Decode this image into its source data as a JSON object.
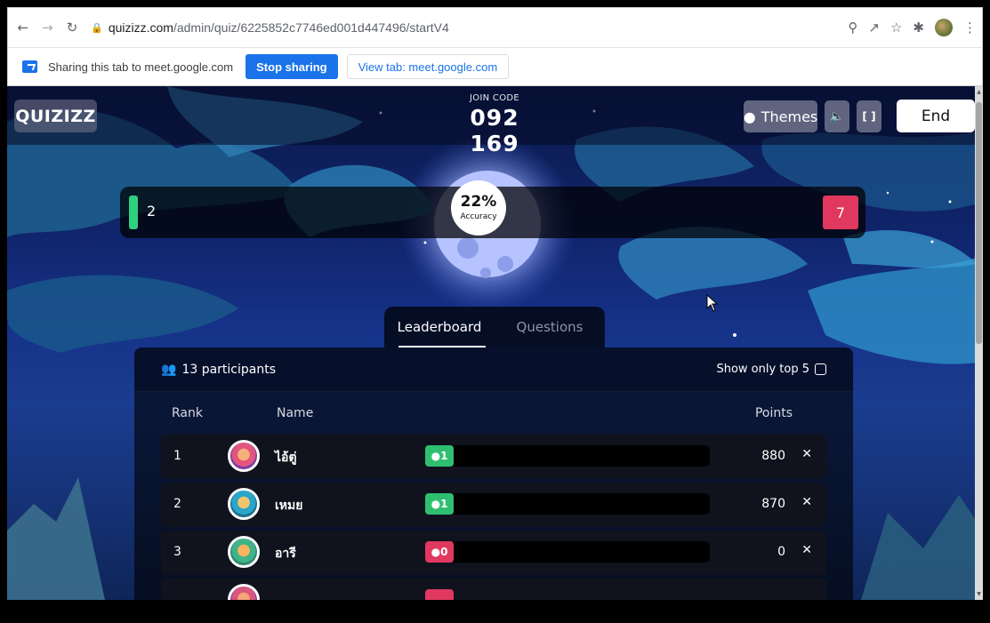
{
  "browser": {
    "url_host": "quizizz.com",
    "url_path": "/admin/quiz/6225852c7746ed001d447496/startV4"
  },
  "sharing": {
    "message": "Sharing this tab to meet.google.com",
    "stop_label": "Stop sharing",
    "view_label": "View tab: meet.google.com"
  },
  "app": {
    "logo": "QUIZIZZ",
    "join_label": "JOIN CODE",
    "join_code": "092 169",
    "themes_label": "Themes",
    "end_label": "End"
  },
  "accuracy": {
    "correct": "2",
    "incorrect": "7",
    "percent": "22%",
    "label": "Accuracy"
  },
  "tabs": [
    "Leaderboard",
    "Questions"
  ],
  "leaderboard": {
    "participants": "13 participants",
    "top5_label": "Show only top 5",
    "headers": {
      "rank": "Rank",
      "name": "Name",
      "points": "Points"
    },
    "rows": [
      {
        "rank": "1",
        "name": "ไอ้ตู่",
        "streak": "1",
        "points": "880"
      },
      {
        "rank": "2",
        "name": "เหมย",
        "streak": "1",
        "points": "870"
      },
      {
        "rank": "3",
        "name": "อารี",
        "streak": "0",
        "points": "0"
      }
    ]
  },
  "colors": {
    "correct": "#2fd07f",
    "incorrect": "#e0385f",
    "chrome_blue": "#1a73e8"
  }
}
